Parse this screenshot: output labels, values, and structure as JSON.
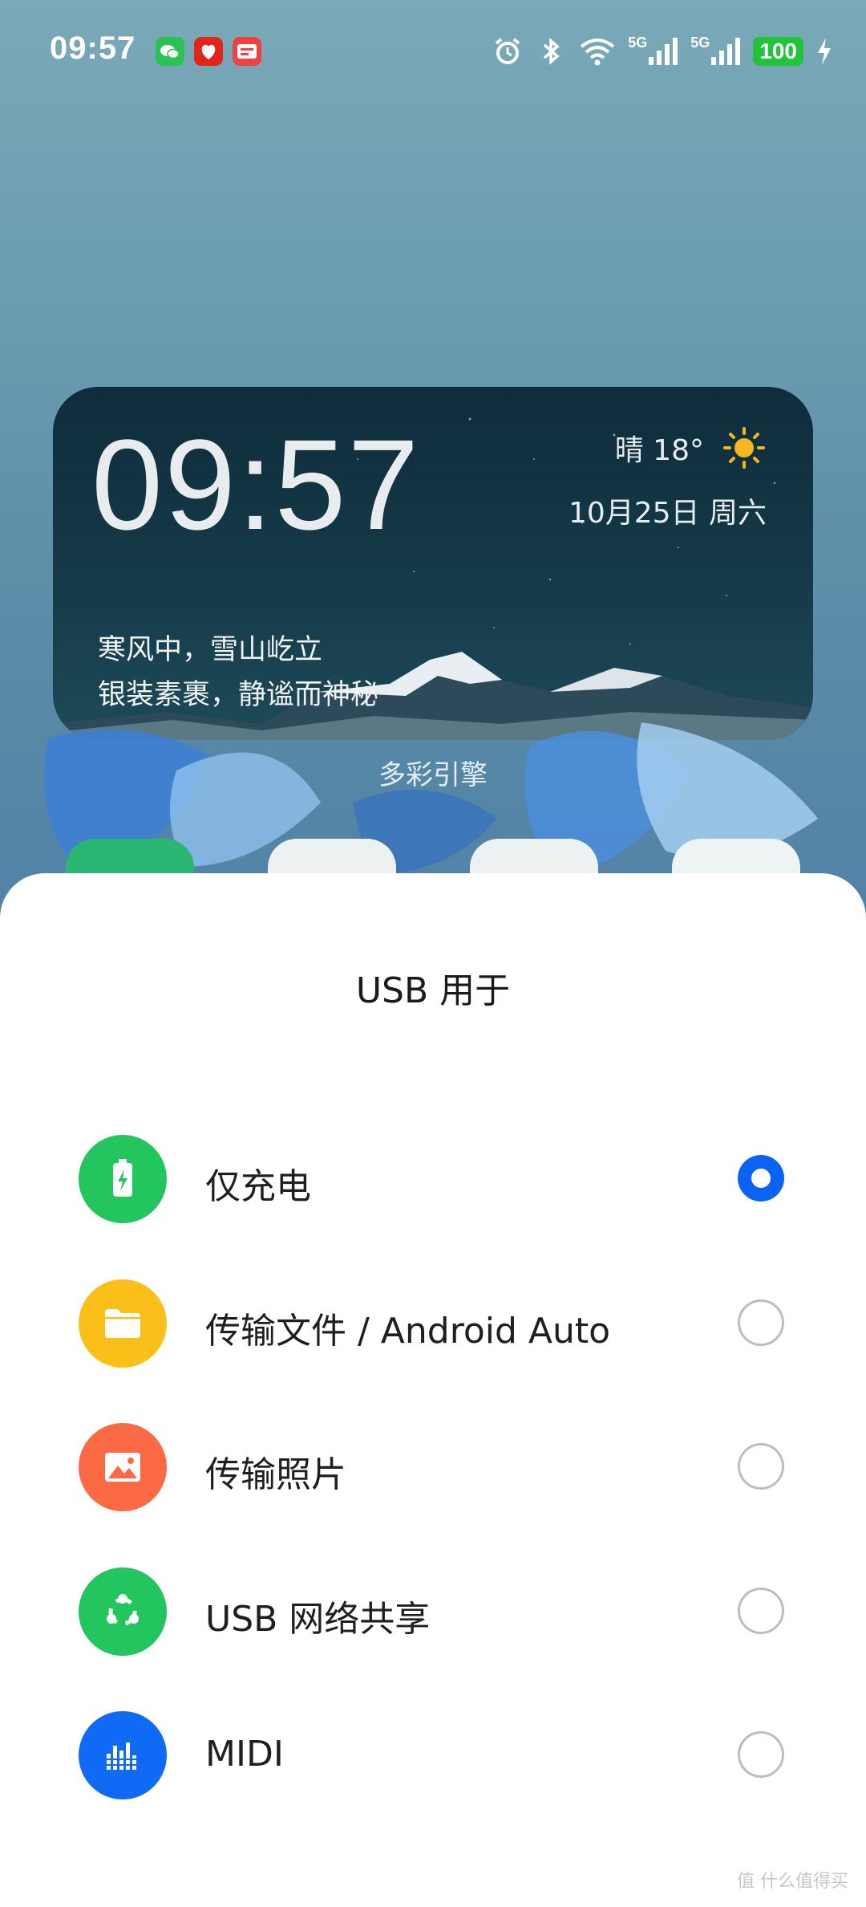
{
  "status_bar": {
    "time": "09:57",
    "network_1": "5G",
    "network_2": "5G",
    "battery": "100",
    "colors": {
      "battery": "#22c33b",
      "wechat": "#2ac255",
      "jd": "#e1251b",
      "toutiao": "#f04142"
    },
    "icons": [
      "wechat-icon",
      "jd-icon",
      "toutiao-icon",
      "alarm-icon",
      "bluetooth-icon",
      "wifi-icon",
      "signal-icon",
      "signal-icon",
      "charging-icon"
    ]
  },
  "widget": {
    "time": "09:57",
    "weather": "晴 18°",
    "date": "10月25日 周六",
    "poem_line1": "寒风中，雪山屹立",
    "poem_line2": "银装素裹，静谧而神秘"
  },
  "wallpaper": {
    "label": "多彩引擎"
  },
  "usb_sheet": {
    "title": "USB 用于",
    "options": [
      {
        "label": "仅充电",
        "selected": true,
        "icon": "battery-charging-icon",
        "color": "#23c55e"
      },
      {
        "label": "传输文件 / Android Auto",
        "selected": false,
        "icon": "folder-icon",
        "color": "#fbbf1a"
      },
      {
        "label": "传输照片",
        "selected": false,
        "icon": "photo-icon",
        "color": "#fb6a45"
      },
      {
        "label": "USB 网络共享",
        "selected": false,
        "icon": "share-network-icon",
        "color": "#23c55e"
      },
      {
        "label": "MIDI",
        "selected": false,
        "icon": "equalizer-icon",
        "color": "#0f6af5"
      }
    ],
    "radio_color": "#0a63f4"
  },
  "watermark": "值 什么值得买"
}
